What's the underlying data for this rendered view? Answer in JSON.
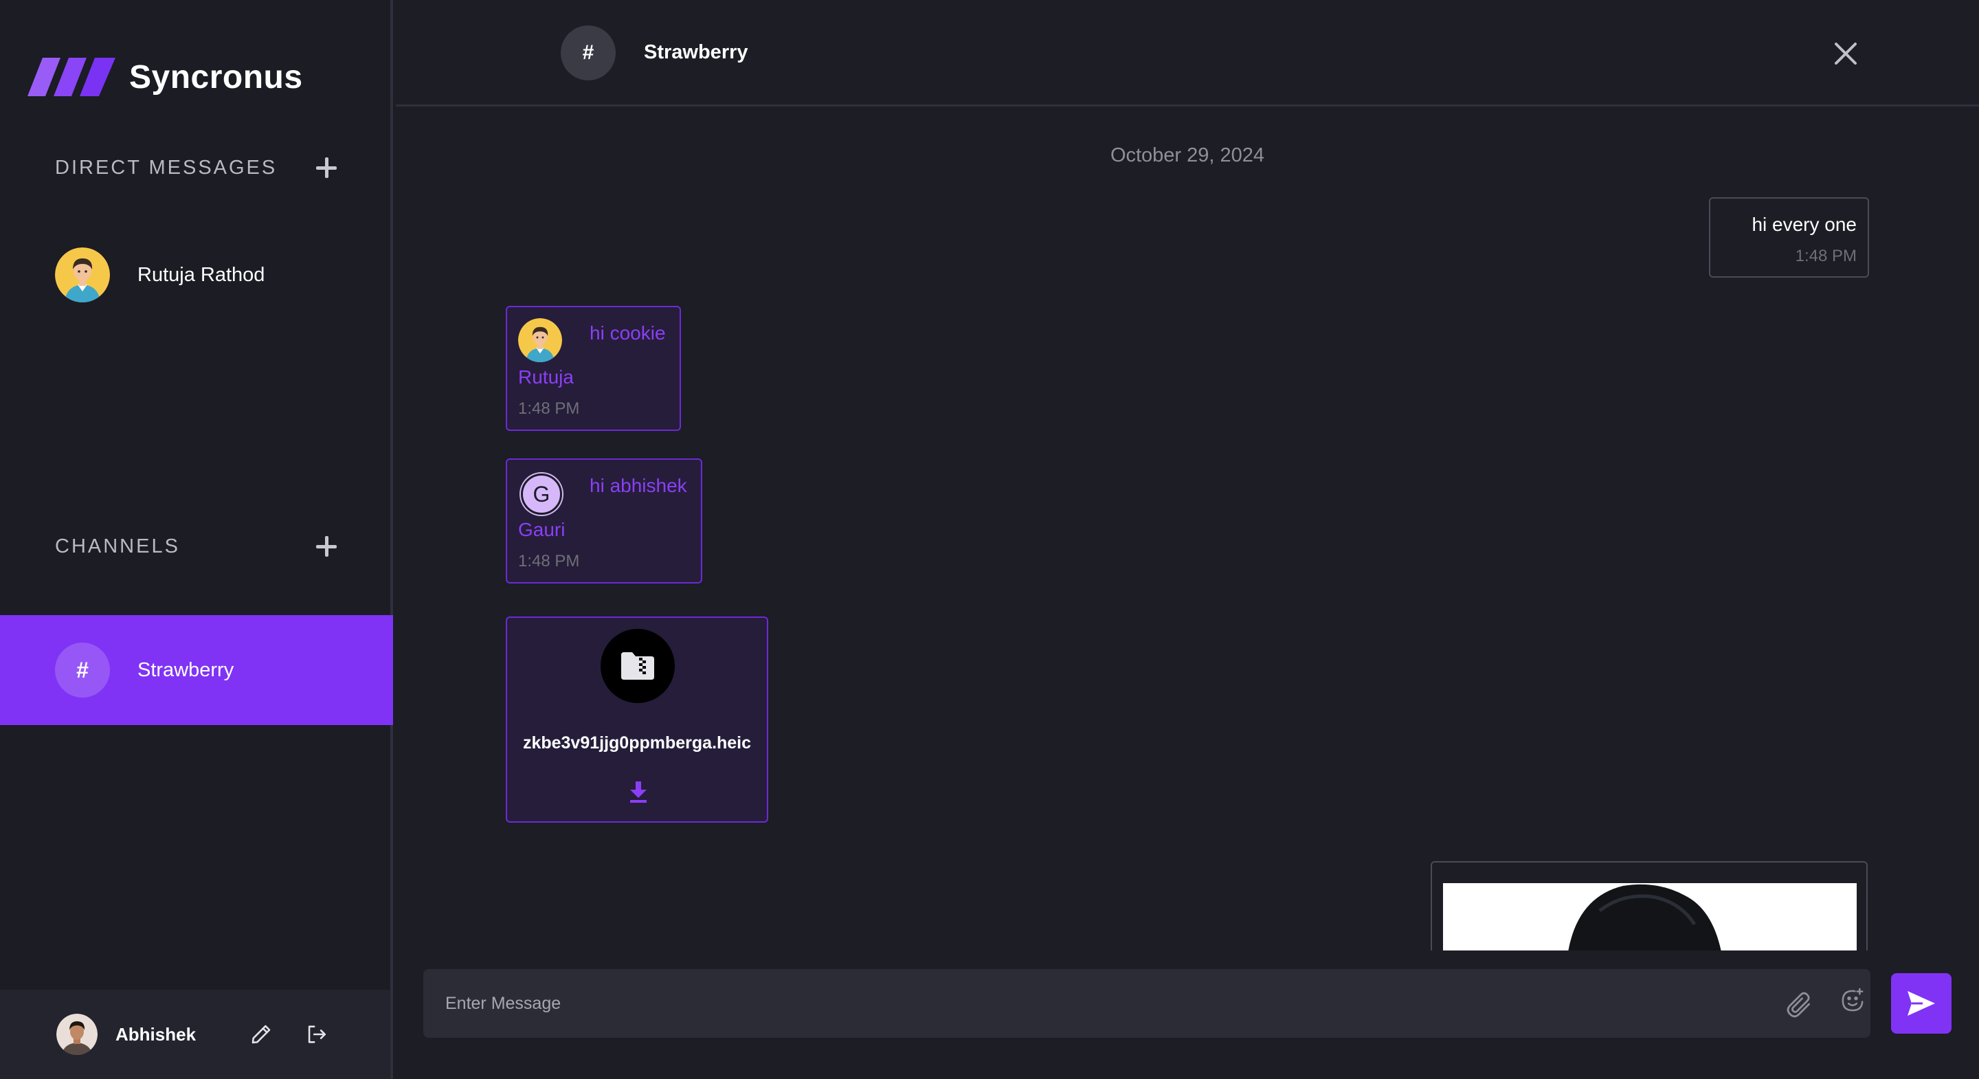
{
  "app": {
    "name": "Syncronus",
    "accent_color": "#8033f5",
    "logo_icon": "slanted-bars-logo"
  },
  "sidebar": {
    "direct_messages": {
      "title": "Direct Messages",
      "add_icon": "plus-icon",
      "contacts": [
        {
          "name": "Rutuja Rathod",
          "avatar": "cartoon-avatar"
        }
      ]
    },
    "channels": {
      "title": "Channels",
      "add_icon": "plus-icon",
      "items": [
        {
          "symbol": "#",
          "name": "Strawberry",
          "active": true
        }
      ]
    },
    "profile": {
      "name": "Abhishek",
      "edit_icon": "pencil-icon",
      "logout_icon": "logout-icon"
    }
  },
  "chat": {
    "header": {
      "symbol": "#",
      "title": "Strawberry",
      "close_icon": "close-icon"
    },
    "date": "October 29, 2024",
    "messages": [
      {
        "type": "outgoing",
        "text": "hi every one",
        "time": "1:48 PM"
      },
      {
        "type": "incoming",
        "sender": "Rutuja",
        "text": "hi cookie",
        "time": "1:48 PM",
        "avatar": "cartoon-avatar"
      },
      {
        "type": "incoming",
        "sender": "Gauri",
        "initial": "G",
        "text": "hi abhishek",
        "time": "1:48 PM"
      },
      {
        "type": "file",
        "file_name": "zkbe3v91jjg0ppmberga.heic",
        "icon": "folder-zip-icon",
        "download_icon": "download-icon"
      },
      {
        "type": "image",
        "icon": "image-preview"
      }
    ],
    "composer": {
      "placeholder": "Enter Message",
      "attach_icon": "paperclip-icon",
      "emoji_icon": "emoji-icon",
      "send_icon": "send-icon"
    }
  }
}
